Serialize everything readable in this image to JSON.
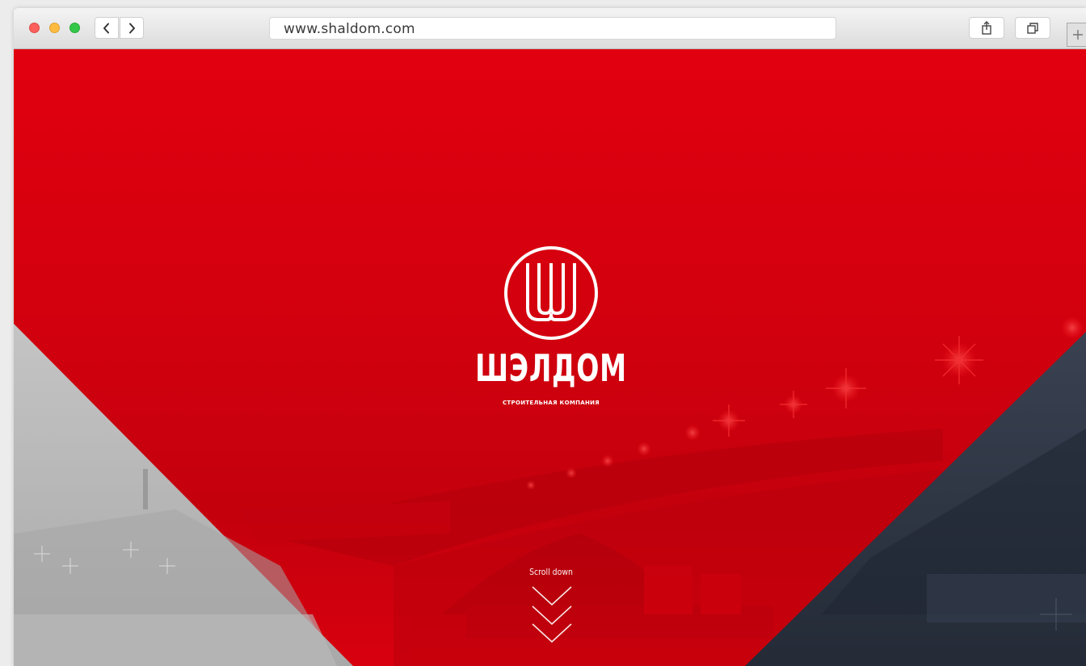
{
  "browser": {
    "url": "www.shaldom.com"
  },
  "icons": {
    "back": "chevron-left-icon",
    "forward": "chevron-right-icon",
    "share": "share-icon",
    "tabs": "tabs-icon",
    "new_tab": "plus-icon"
  },
  "hero": {
    "brand_name": "ШЭЛДОМ",
    "tagline": "СТРОИТЕЛЬНАЯ КОМПАНИЯ",
    "scroll_label": "Scroll down"
  },
  "colors": {
    "brand_red": "#e0000f",
    "left_panel_gray": "#b9b9b9",
    "right_panel_navy": "#2d3544"
  }
}
